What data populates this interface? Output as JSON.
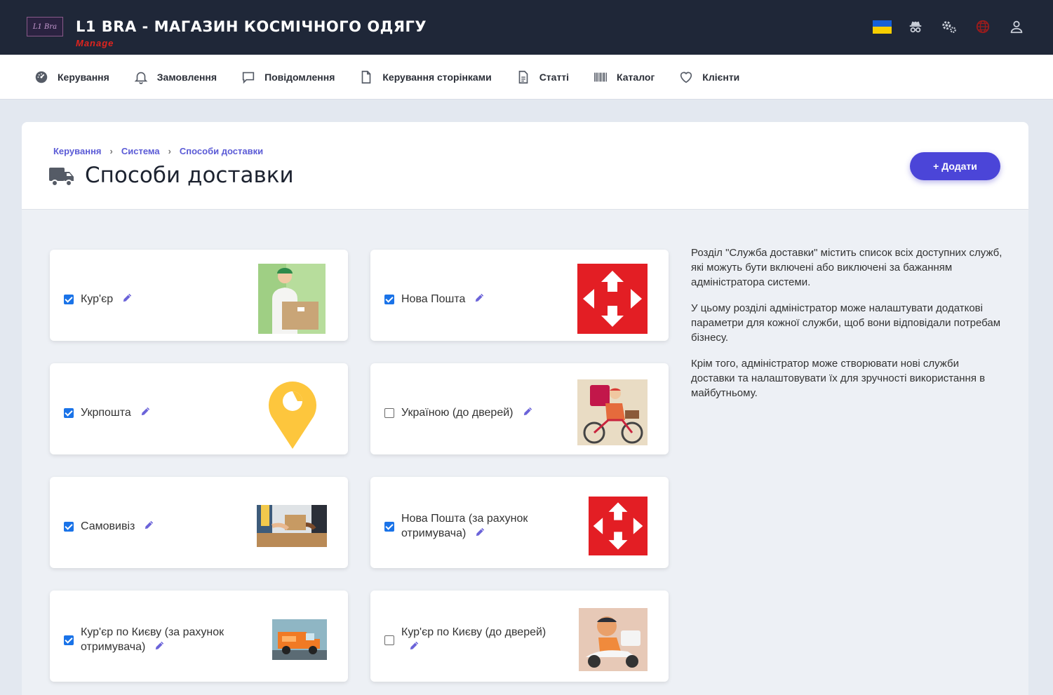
{
  "header": {
    "logo_text": "L1 Bra",
    "title": "L1 BRA - МАГАЗИН КОСМІЧНОГО ОДЯГУ",
    "subtitle": "Manage"
  },
  "nav": [
    {
      "label": "Керування",
      "icon": "dashboard-icon"
    },
    {
      "label": "Замовлення",
      "icon": "bell-icon"
    },
    {
      "label": "Повідомлення",
      "icon": "message-icon"
    },
    {
      "label": "Керування сторінками",
      "icon": "file-icon"
    },
    {
      "label": "Статті",
      "icon": "document-icon"
    },
    {
      "label": "Каталог",
      "icon": "barcode-icon"
    },
    {
      "label": "Клієнти",
      "icon": "heart-icon"
    }
  ],
  "breadcrumbs": [
    "Керування",
    "Система",
    "Способи доставки"
  ],
  "page": {
    "title": "Способи доставки",
    "add_label": "+ Додати"
  },
  "methods": [
    {
      "name": "Кур'єр",
      "enabled": true
    },
    {
      "name": "Нова Пошта",
      "enabled": true
    },
    {
      "name": "Укрпошта",
      "enabled": true
    },
    {
      "name": "Україною (до дверей)",
      "enabled": false
    },
    {
      "name": "Самовивіз",
      "enabled": true
    },
    {
      "name": "Нова Пошта (за рахунок отримувача)",
      "enabled": true
    },
    {
      "name": "Кур'єр по Києву (за рахунок отримувача)",
      "enabled": true
    },
    {
      "name": "Кур'єр по Києву (до дверей)",
      "enabled": false
    }
  ],
  "info": [
    "Розділ \"Служба доставки\" містить список всіх доступних служб, які можуть бути включені або виключені за бажанням адміністратора системи.",
    "У цьому розділі адміністратор може налаштувати додаткові параметри для кожної служби, щоб вони відповідали потребам бізнесу.",
    "Крім того, адміністратор може створювати нові служби доставки та налаштовувати їх для зручності використання в майбутньому."
  ],
  "colors": {
    "header_bg": "#1f2738",
    "accent": "#4b45d8",
    "nova_poshta_red": "#e31e24",
    "ukrposhta_yellow": "#fdc63d"
  }
}
